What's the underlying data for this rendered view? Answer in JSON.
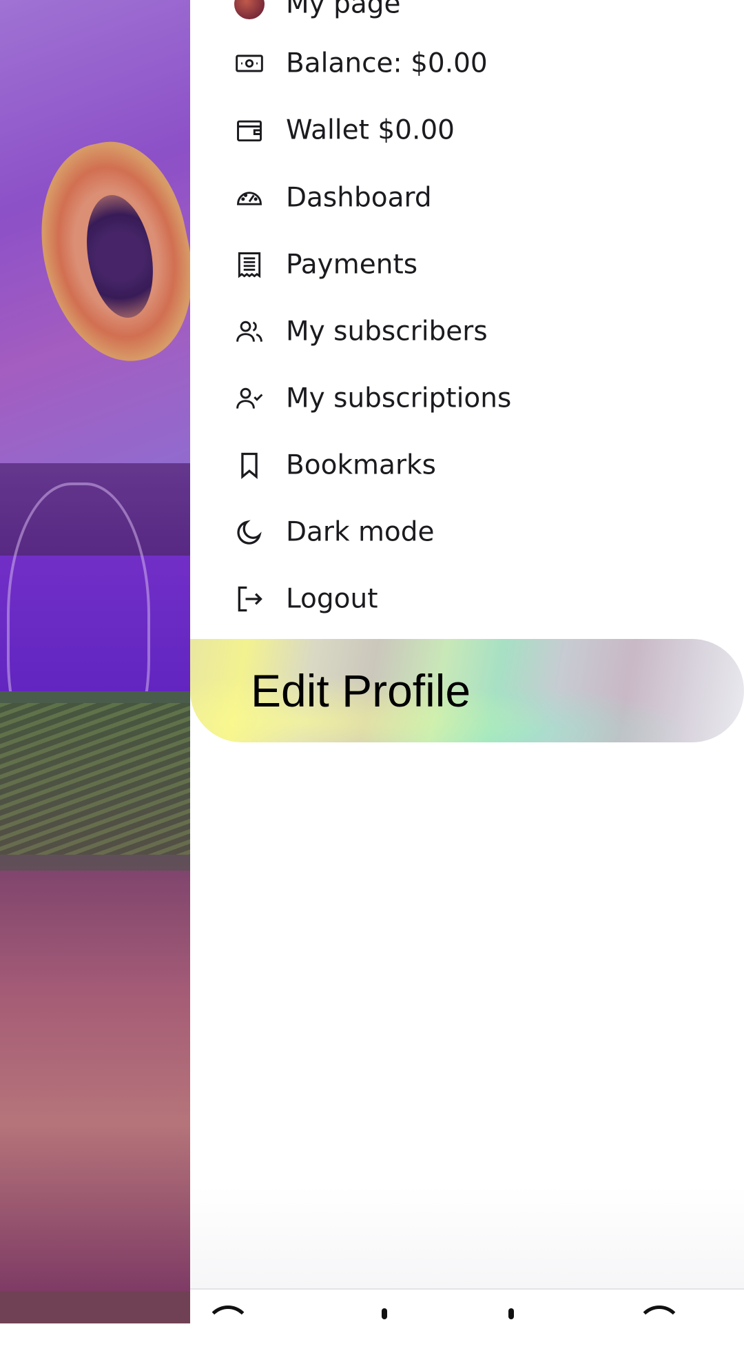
{
  "menu": {
    "items": [
      {
        "label": "My page",
        "icon": "avatar"
      },
      {
        "label": "Balance: $0.00",
        "icon": "banknote-icon"
      },
      {
        "label": "Wallet $0.00",
        "icon": "wallet-icon"
      },
      {
        "label": "Dashboard",
        "icon": "speedometer-icon"
      },
      {
        "label": "Payments",
        "icon": "receipt-icon"
      },
      {
        "label": "My subscribers",
        "icon": "users-icon"
      },
      {
        "label": "My subscriptions",
        "icon": "user-check-icon"
      },
      {
        "label": "Bookmarks",
        "icon": "bookmark-icon"
      },
      {
        "label": "Dark mode",
        "icon": "moon-icon"
      },
      {
        "label": "Logout",
        "icon": "logout-icon"
      }
    ]
  },
  "edit_profile": {
    "label": "Edit Profile"
  },
  "colors": {
    "text": "#1b1b1f",
    "icon": "#1b1b1f",
    "drawer_bg": "#ffffff",
    "backdrop_tint": "#9a5cd8"
  }
}
